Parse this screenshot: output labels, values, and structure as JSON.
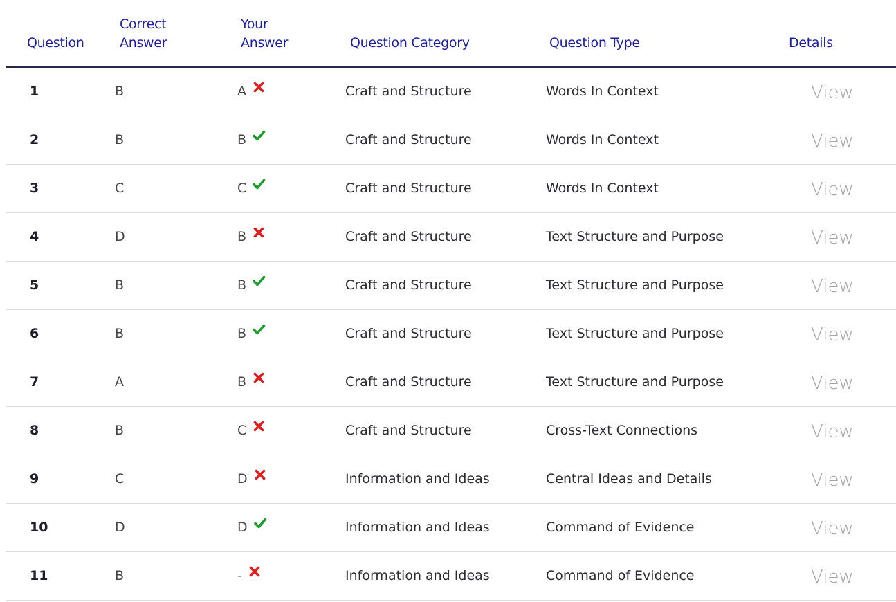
{
  "header": {
    "question": "Question",
    "correct_answer_line1": "Correct",
    "correct_answer_line2": "Answer",
    "your_answer_line1": "Your",
    "your_answer_line2": "Answer",
    "category": "Question Category",
    "type": "Question Type",
    "details": "Details"
  },
  "colors": {
    "header_text": "#1d1ea8",
    "correct_mark": "#1a9e2c",
    "incorrect_mark": "#e31b1b",
    "view_link": "#a2a4ad"
  },
  "rows": [
    {
      "num": "1",
      "correct": "B",
      "yours": "A",
      "result": "incorrect",
      "result_icon": "x-icon",
      "category": "Craft and Structure",
      "type": "Words In Context",
      "details": "View"
    },
    {
      "num": "2",
      "correct": "B",
      "yours": "B",
      "result": "correct",
      "result_icon": "check-icon",
      "category": "Craft and Structure",
      "type": "Words In Context",
      "details": "View"
    },
    {
      "num": "3",
      "correct": "C",
      "yours": "C",
      "result": "correct",
      "result_icon": "check-icon",
      "category": "Craft and Structure",
      "type": "Words In Context",
      "details": "View"
    },
    {
      "num": "4",
      "correct": "D",
      "yours": "B",
      "result": "incorrect",
      "result_icon": "x-icon",
      "category": "Craft and Structure",
      "type": "Text Structure and Purpose",
      "details": "View"
    },
    {
      "num": "5",
      "correct": "B",
      "yours": "B",
      "result": "correct",
      "result_icon": "check-icon",
      "category": "Craft and Structure",
      "type": "Text Structure and Purpose",
      "details": "View"
    },
    {
      "num": "6",
      "correct": "B",
      "yours": "B",
      "result": "correct",
      "result_icon": "check-icon",
      "category": "Craft and Structure",
      "type": "Text Structure and Purpose",
      "details": "View"
    },
    {
      "num": "7",
      "correct": "A",
      "yours": "B",
      "result": "incorrect",
      "result_icon": "x-icon",
      "category": "Craft and Structure",
      "type": "Text Structure and Purpose",
      "details": "View"
    },
    {
      "num": "8",
      "correct": "B",
      "yours": "C",
      "result": "incorrect",
      "result_icon": "x-icon",
      "category": "Craft and Structure",
      "type": "Cross-Text Connections",
      "details": "View"
    },
    {
      "num": "9",
      "correct": "C",
      "yours": "D",
      "result": "incorrect",
      "result_icon": "x-icon",
      "category": "Information and Ideas",
      "type": "Central Ideas and Details",
      "details": "View"
    },
    {
      "num": "10",
      "correct": "D",
      "yours": "D",
      "result": "correct",
      "result_icon": "check-icon",
      "category": "Information and Ideas",
      "type": "Command of Evidence",
      "details": "View"
    },
    {
      "num": "11",
      "correct": "B",
      "yours": "-",
      "result": "incorrect",
      "result_icon": "x-icon",
      "category": "Information and Ideas",
      "type": "Command of Evidence",
      "details": "View"
    }
  ]
}
